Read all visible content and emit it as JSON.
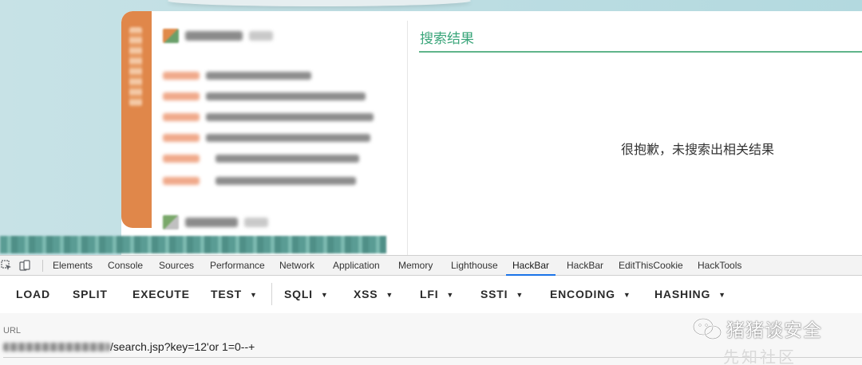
{
  "search_results": {
    "title": "搜索结果",
    "empty_message": "很抱歉，未搜索出相关结果"
  },
  "devtools": {
    "tabs": [
      {
        "label": "Elements"
      },
      {
        "label": "Console"
      },
      {
        "label": "Sources"
      },
      {
        "label": "Performance"
      },
      {
        "label": "Network"
      },
      {
        "label": "Application"
      },
      {
        "label": "Memory"
      },
      {
        "label": "Lighthouse"
      },
      {
        "label": "HackBar",
        "active": true
      },
      {
        "label": "HackBar"
      },
      {
        "label": "EditThisCookie"
      },
      {
        "label": "HackTools"
      }
    ],
    "active_tab_color": "#1a73e8"
  },
  "hackbar": {
    "buttons": {
      "load": "LOAD",
      "split": "SPLIT",
      "execute": "EXECUTE",
      "test": "TEST",
      "sqli": "SQLI",
      "xss": "XSS",
      "lfi": "LFI",
      "ssti": "SSTI",
      "encoding": "ENCODING",
      "hashing": "HASHING"
    },
    "url_label": "URL",
    "url_value_visible": "/search.jsp?key=12'or 1=0--+"
  },
  "watermark": {
    "text": "猪猪谈安全",
    "subtext": "先知社区"
  },
  "colors": {
    "accent_green": "#3aa57a",
    "orange_tab": "#e0874a",
    "page_bg": "#c7e2e6"
  }
}
